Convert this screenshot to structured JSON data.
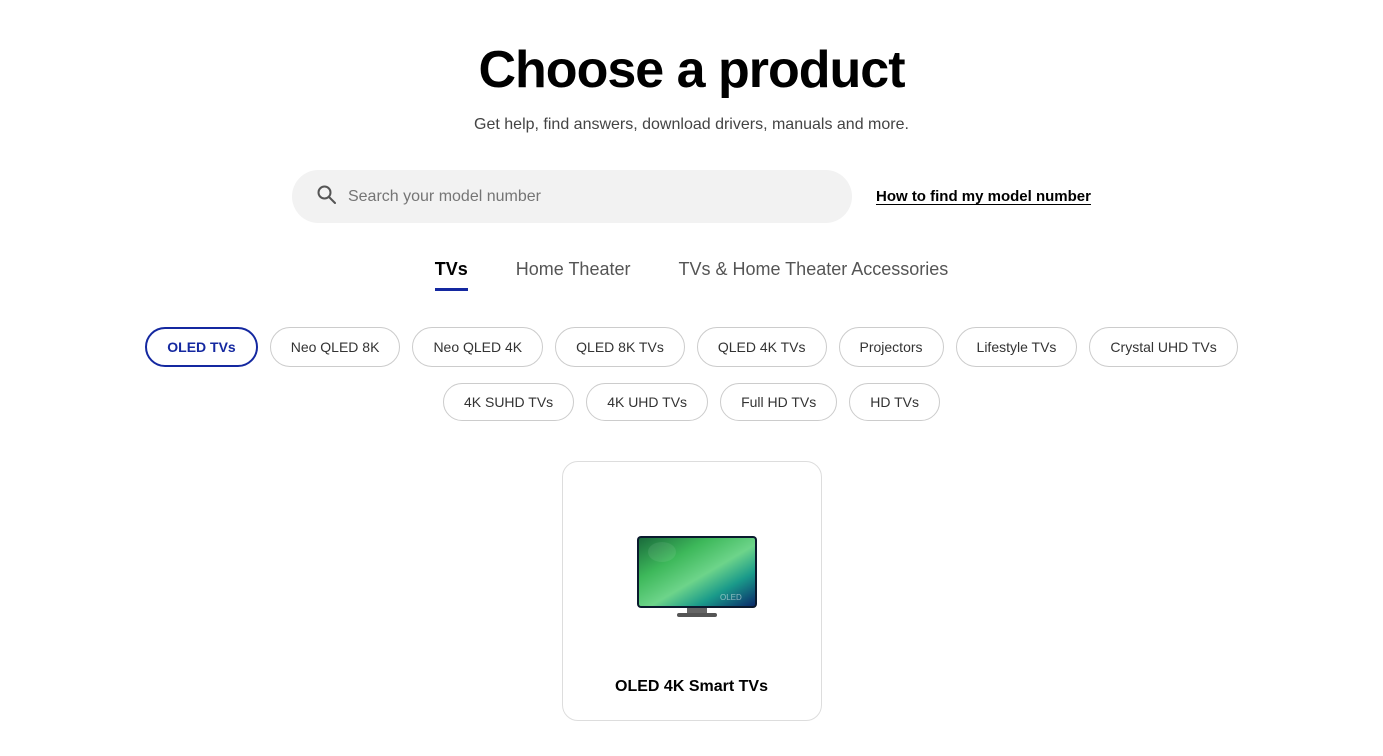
{
  "page": {
    "title": "Choose a product",
    "subtitle": "Get help, find answers, download drivers, manuals and more."
  },
  "search": {
    "placeholder": "Search your model number",
    "model_number_link": "How to find my model number"
  },
  "tabs": [
    {
      "id": "tvs",
      "label": "TVs",
      "active": true
    },
    {
      "id": "home-theater",
      "label": "Home Theater",
      "active": false
    },
    {
      "id": "accessories",
      "label": "TVs & Home Theater Accessories",
      "active": false
    }
  ],
  "filters": {
    "row1": [
      {
        "id": "oled-tvs",
        "label": "OLED TVs",
        "active": true
      },
      {
        "id": "neo-qled-8k",
        "label": "Neo QLED 8K",
        "active": false
      },
      {
        "id": "neo-qled-4k",
        "label": "Neo QLED 4K",
        "active": false
      },
      {
        "id": "qled-8k-tvs",
        "label": "QLED 8K TVs",
        "active": false
      },
      {
        "id": "qled-4k-tvs",
        "label": "QLED 4K TVs",
        "active": false
      },
      {
        "id": "projectors",
        "label": "Projectors",
        "active": false
      },
      {
        "id": "lifestyle-tvs",
        "label": "Lifestyle TVs",
        "active": false
      },
      {
        "id": "crystal-uhd-tvs",
        "label": "Crystal UHD TVs",
        "active": false
      }
    ],
    "row2": [
      {
        "id": "4k-suhd-tvs",
        "label": "4K SUHD TVs",
        "active": false
      },
      {
        "id": "4k-uhd-tvs",
        "label": "4K UHD TVs",
        "active": false
      },
      {
        "id": "full-hd-tvs",
        "label": "Full HD TVs",
        "active": false
      },
      {
        "id": "hd-tvs",
        "label": "HD TVs",
        "active": false
      }
    ]
  },
  "products": [
    {
      "id": "oled-4k-smart-tvs",
      "label": "OLED 4K Smart TVs"
    }
  ],
  "colors": {
    "active_tab_border": "#1428a0",
    "active_filter_border": "#1428a0",
    "active_filter_text": "#1428a0"
  }
}
